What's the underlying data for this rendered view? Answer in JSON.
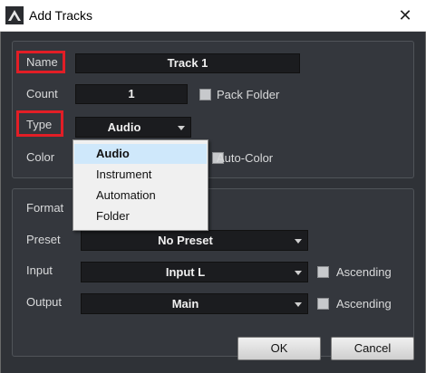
{
  "window": {
    "title": "Add Tracks",
    "close_glyph": "✕",
    "app_icon": "studio-one-icon"
  },
  "form": {
    "name_label": "Name",
    "name_value": "Track 1",
    "count_label": "Count",
    "count_value": "1",
    "pack_folder_label": "Pack Folder",
    "pack_folder_checked": false,
    "type_label": "Type",
    "type_value": "Audio",
    "color_label": "Color",
    "auto_color_label": "Auto-Color",
    "auto_color_checked": false,
    "format_label": "Format",
    "preset_label": "Preset",
    "preset_value": "No Preset",
    "input_label": "Input",
    "input_value": "Input L",
    "input_ascending_label": "Ascending",
    "input_ascending_checked": false,
    "output_label": "Output",
    "output_value": "Main",
    "output_ascending_label": "Ascending",
    "output_ascending_checked": false
  },
  "type_menu": {
    "items": [
      "Audio",
      "Instrument",
      "Automation",
      "Folder"
    ],
    "selected": "Audio"
  },
  "buttons": {
    "ok_label": "OK",
    "cancel_label": "Cancel"
  },
  "colors": {
    "highlight_box": "#e21e26",
    "menu_selection": "#cfe8fb",
    "dialog_background": "#2f3237"
  }
}
